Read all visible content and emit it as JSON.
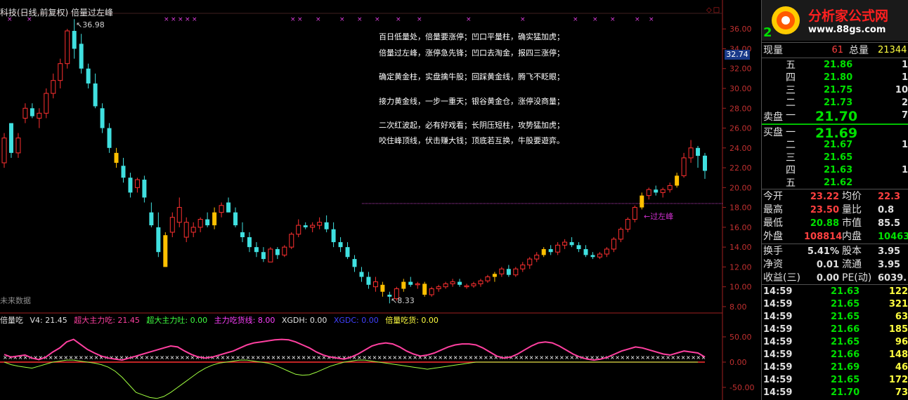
{
  "chart": {
    "title": "科技(日线,前复权) 倍量过左峰",
    "current_price_label": "32.74",
    "high_marker": "36.98",
    "low_marker": "8.33",
    "future_label": "未来数据",
    "breakout_label": "过左峰",
    "window_buttons": "◇□",
    "price_ticks": [
      "36.00",
      "34.00",
      "32.00",
      "30.00",
      "28.00",
      "26.00",
      "24.00",
      "22.00",
      "20.00",
      "18.00",
      "16.00",
      "14.00",
      "12.00",
      "10.00",
      "8.00"
    ],
    "poem_lines": [
      "百日低量处，倍量要涨停；凹口平量柱，确实猛加虎；",
      "倍量过左峰，涨停急先锋；凹口去淘金，报四三涨停；",
      "确定黄金柱，实盘擒牛股；回踩黄金线，腾飞不眨眼；",
      "接力黄金线，一步一重天；银谷黄金仓，涨停没商量；",
      "二次红波起，必有好戏看；长阴压短柱，攻势猛加虎；",
      "咬住峰顶线，伏击赚大钱；顶底若互换，牛股要遊弈。"
    ],
    "colors": {
      "up": "#ff3030",
      "down": "#40e0e0",
      "gold": "#ffc000",
      "ind_pink": "#ff40a0",
      "ind_green": "#a0ff40",
      "ind_white": "#ffffff"
    }
  },
  "indicator": {
    "name": "倍量吃",
    "v4": "V4: 21.45",
    "main_eat": "超大主力吃: 21.45",
    "main_spit": "超大主力吐: 0.00",
    "main_accum": "主力吃货线: 8.00",
    "xgdh": "XGDH: 0.00",
    "xgdc": "XGDC: 0.00",
    "double_eat": "倍量吃货: 0.00",
    "ticks": [
      "50.00",
      "0.00",
      "-50.00"
    ]
  },
  "panel": {
    "logo_text": "分析家公式网",
    "logo_url": "www.88gs.com",
    "code_partial": "2",
    "volume": {
      "now_label": "现量",
      "now_value": "61",
      "total_label": "总量",
      "total_value": "21344"
    },
    "asks": [
      {
        "label": "五",
        "price": "21.86",
        "vol": "1"
      },
      {
        "label": "四",
        "price": "21.80",
        "vol": "1"
      },
      {
        "label": "三",
        "price": "21.75",
        "vol": "10"
      },
      {
        "label": "二",
        "price": "21.73",
        "vol": "2"
      },
      {
        "label": "一",
        "price": "21.70",
        "vol": "7"
      }
    ],
    "ask_side_label": "卖盘",
    "bid_side_label": "买盘",
    "bids": [
      {
        "label": "一",
        "price": "21.69",
        "vol": ""
      },
      {
        "label": "二",
        "price": "21.67",
        "vol": "1"
      },
      {
        "label": "三",
        "price": "21.65",
        "vol": ""
      },
      {
        "label": "四",
        "price": "21.63",
        "vol": "1"
      },
      {
        "label": "五",
        "price": "21.62",
        "vol": ""
      }
    ],
    "stats": [
      {
        "l1": "今开",
        "v1": "23.22",
        "l2": "均价",
        "v2": "22.3"
      },
      {
        "l1": "最高",
        "v1": "23.50",
        "l2": "量比",
        "v2": "0.8"
      },
      {
        "l1": "最低",
        "v1": "20.88",
        "l2": "市值",
        "v2": "85.5"
      },
      {
        "l1": "外盘",
        "v1": "108814",
        "l2": "内盘",
        "v2": "10463"
      }
    ],
    "fundamentals": [
      {
        "l1": "换手",
        "v1": "5.41%",
        "l2": "股本",
        "v2": "3.95"
      },
      {
        "l1": "净资",
        "v1": "0.01",
        "l2": "流通",
        "v2": "3.95"
      },
      {
        "l1": "收益(三)",
        "v1": "0.00",
        "l2": "PE(动)",
        "v2": "6039."
      }
    ],
    "ticks": [
      {
        "time": "14:59",
        "price": "21.63",
        "vol": "122"
      },
      {
        "time": "14:59",
        "price": "21.65",
        "vol": "321"
      },
      {
        "time": "14:59",
        "price": "21.65",
        "vol": "63"
      },
      {
        "time": "14:59",
        "price": "21.66",
        "vol": "185"
      },
      {
        "time": "14:59",
        "price": "21.65",
        "vol": "96"
      },
      {
        "time": "14:59",
        "price": "21.66",
        "vol": "148"
      },
      {
        "time": "14:59",
        "price": "21.69",
        "vol": "46"
      },
      {
        "time": "14:59",
        "price": "21.65",
        "vol": "172"
      },
      {
        "time": "14:59",
        "price": "21.70",
        "vol": "73"
      }
    ]
  },
  "chart_data": {
    "type": "candlestick",
    "y_range": [
      7.5,
      37.5
    ],
    "candles": [
      [
        22.5,
        25.5,
        22.0,
        25.0
      ],
      [
        26.5,
        26.5,
        23.0,
        23.5
      ],
      [
        23.5,
        25.5,
        23.0,
        25.0
      ],
      [
        27.0,
        28.5,
        26.5,
        28.0
      ],
      [
        28.0,
        28.5,
        27.0,
        27.2
      ],
      [
        27.0,
        28.0,
        26.0,
        27.5
      ],
      [
        27.5,
        30.0,
        27.0,
        29.5
      ],
      [
        29.5,
        31.5,
        29.0,
        30.8
      ],
      [
        30.8,
        33.0,
        30.0,
        32.5
      ],
      [
        32.5,
        36.0,
        32.0,
        35.8
      ],
      [
        35.8,
        36.98,
        33.0,
        34.0
      ],
      [
        34.5,
        35.5,
        31.5,
        32.0
      ],
      [
        32.0,
        32.5,
        30.0,
        30.5
      ],
      [
        30.5,
        31.5,
        28.0,
        28.2
      ],
      [
        28.0,
        28.5,
        25.5,
        26.0
      ],
      [
        26.0,
        26.5,
        23.5,
        24.0
      ],
      [
        23.5,
        24.0,
        22.0,
        22.5
      ],
      [
        22.2,
        23.0,
        20.5,
        21.0
      ],
      [
        21.0,
        21.5,
        19.0,
        19.5
      ],
      [
        20.0,
        21.0,
        19.5,
        20.8
      ],
      [
        20.8,
        21.2,
        18.5,
        19.0
      ],
      [
        17.5,
        18.5,
        16.0,
        16.2
      ],
      [
        16.0,
        17.5,
        13.0,
        13.5
      ],
      [
        12.0,
        15.5,
        12.0,
        15.2
      ],
      [
        15.5,
        17.5,
        15.0,
        17.0
      ],
      [
        16.5,
        19.0,
        16.0,
        18.0
      ],
      [
        15.0,
        17.0,
        14.5,
        16.5
      ],
      [
        15.5,
        16.5,
        15.0,
        16.0
      ],
      [
        16.0,
        17.0,
        15.5,
        16.8
      ],
      [
        16.8,
        17.5,
        16.0,
        16.2
      ],
      [
        16.2,
        18.0,
        15.8,
        17.5
      ],
      [
        17.5,
        18.5,
        17.0,
        18.2
      ],
      [
        18.5,
        19.0,
        17.5,
        17.5
      ],
      [
        17.5,
        18.0,
        16.0,
        16.2
      ],
      [
        15.5,
        16.5,
        14.5,
        15.0
      ],
      [
        15.0,
        15.5,
        13.5,
        14.0
      ],
      [
        14.0,
        14.5,
        13.0,
        13.5
      ],
      [
        13.5,
        14.0,
        12.5,
        12.8
      ],
      [
        12.5,
        14.0,
        12.5,
        13.8
      ],
      [
        13.8,
        14.0,
        12.8,
        13.2
      ],
      [
        13.2,
        14.2,
        13.0,
        14.0
      ],
      [
        14.0,
        15.5,
        13.8,
        15.3
      ],
      [
        15.3,
        16.8,
        15.0,
        16.2
      ],
      [
        16.2,
        16.5,
        15.8,
        16.0
      ],
      [
        16.0,
        16.5,
        15.5,
        16.2
      ],
      [
        16.2,
        17.0,
        15.8,
        16.5
      ],
      [
        16.5,
        17.2,
        15.5,
        15.8
      ],
      [
        15.8,
        16.5,
        14.0,
        14.5
      ],
      [
        14.5,
        15.0,
        13.5,
        14.0
      ],
      [
        14.0,
        14.5,
        12.8,
        13.0
      ],
      [
        12.8,
        13.2,
        11.5,
        12.0
      ],
      [
        11.5,
        12.0,
        10.5,
        11.0
      ],
      [
        11.0,
        11.5,
        9.8,
        10.2
      ],
      [
        10.0,
        11.0,
        9.5,
        10.5
      ],
      [
        10.2,
        10.5,
        9.0,
        9.5
      ],
      [
        9.2,
        9.5,
        8.33,
        9.0
      ],
      [
        8.8,
        10.0,
        8.6,
        9.8
      ],
      [
        9.8,
        10.8,
        9.5,
        10.5
      ],
      [
        10.5,
        11.0,
        10.0,
        10.2
      ],
      [
        10.2,
        10.5,
        9.8,
        10.3
      ],
      [
        10.3,
        10.5,
        9.0,
        9.2
      ],
      [
        9.2,
        10.0,
        9.0,
        9.8
      ],
      [
        9.8,
        10.2,
        9.5,
        10.0
      ],
      [
        10.0,
        10.5,
        9.8,
        10.3
      ],
      [
        10.3,
        10.8,
        10.0,
        10.5
      ],
      [
        10.5,
        10.8,
        10.0,
        10.2
      ],
      [
        10.0,
        10.3,
        9.8,
        10.1
      ],
      [
        10.1,
        10.5,
        9.9,
        10.3
      ],
      [
        10.3,
        10.8,
        10.0,
        10.6
      ],
      [
        10.6,
        11.2,
        10.4,
        11.0
      ],
      [
        11.0,
        11.5,
        10.5,
        11.3
      ],
      [
        11.3,
        12.0,
        11.0,
        11.8
      ],
      [
        11.8,
        12.2,
        11.0,
        11.2
      ],
      [
        11.2,
        12.0,
        11.0,
        11.8
      ],
      [
        11.8,
        12.5,
        11.5,
        12.2
      ],
      [
        12.2,
        13.0,
        11.8,
        12.8
      ],
      [
        12.8,
        13.5,
        12.5,
        13.2
      ],
      [
        13.2,
        14.0,
        13.0,
        13.8
      ],
      [
        13.8,
        14.2,
        13.2,
        13.5
      ],
      [
        13.5,
        14.5,
        13.2,
        14.2
      ],
      [
        14.2,
        14.8,
        13.8,
        14.5
      ],
      [
        14.5,
        15.0,
        14.0,
        14.2
      ],
      [
        14.2,
        14.5,
        13.5,
        13.8
      ],
      [
        13.8,
        14.2,
        13.0,
        13.2
      ],
      [
        13.2,
        13.5,
        12.8,
        13.0
      ],
      [
        13.0,
        13.5,
        12.8,
        13.3
      ],
      [
        13.3,
        14.0,
        13.0,
        13.8
      ],
      [
        13.8,
        15.0,
        13.5,
        14.8
      ],
      [
        14.8,
        16.0,
        14.5,
        15.8
      ],
      [
        15.8,
        17.0,
        15.5,
        16.8
      ],
      [
        16.8,
        18.2,
        16.5,
        18.0
      ],
      [
        18.0,
        19.5,
        17.8,
        19.2
      ],
      [
        19.2,
        20.0,
        18.8,
        19.8
      ],
      [
        19.8,
        20.2,
        19.2,
        19.5
      ],
      [
        19.5,
        20.0,
        19.0,
        19.8
      ],
      [
        19.8,
        20.5,
        19.5,
        20.2
      ],
      [
        20.2,
        21.5,
        20.0,
        21.2
      ],
      [
        21.2,
        23.5,
        21.0,
        23.0
      ],
      [
        23.0,
        24.8,
        22.5,
        24.0
      ],
      [
        24.0,
        24.2,
        22.0,
        23.2
      ],
      [
        23.22,
        23.5,
        20.88,
        21.69
      ]
    ],
    "gold_bars": [
      16,
      23,
      30,
      54,
      57,
      60,
      70,
      77,
      91,
      96
    ],
    "indicator_series": [
      {
        "name": "超大主力吃",
        "values": [
          15,
          10,
          12,
          14,
          8,
          5,
          10,
          20,
          28,
          40,
          45,
          35,
          25,
          18,
          12,
          8,
          6,
          4,
          8,
          12,
          16,
          20,
          24,
          28,
          32,
          30,
          22,
          15,
          10,
          8,
          10,
          14,
          18,
          22,
          28,
          34,
          38,
          40,
          42,
          44,
          45,
          44,
          40,
          34,
          28,
          20,
          14,
          10,
          8,
          6,
          10,
          16,
          24,
          32,
          36,
          38,
          36,
          30,
          22,
          16,
          12,
          14,
          18,
          24,
          30,
          34,
          36,
          36,
          34,
          28,
          20,
          12,
          8,
          10,
          16,
          24,
          32,
          38,
          40,
          38,
          32,
          24,
          16,
          10,
          6,
          4,
          6,
          10,
          16,
          22,
          26,
          30,
          28,
          24,
          20,
          16,
          14,
          18,
          22,
          20,
          18,
          10
        ]
      },
      {
        "name": "主力吃货线",
        "values": [
          0,
          -5,
          -8,
          -10,
          -12,
          -8,
          -4,
          0,
          2,
          4,
          4,
          2,
          0,
          -2,
          -5,
          -10,
          -18,
          -30,
          -45,
          -60,
          -65,
          -70,
          -72,
          -68,
          -60,
          -50,
          -40,
          -30,
          -20,
          -12,
          -6,
          -2,
          0,
          2,
          4,
          4,
          2,
          0,
          -2,
          -6,
          -12,
          -18,
          -24,
          -26,
          -25,
          -20,
          -14,
          -8,
          -4,
          0,
          2,
          4,
          4,
          2,
          0,
          -2,
          -4,
          -6,
          -8,
          -10,
          -12,
          -14,
          -12,
          -10,
          -8,
          -6,
          -4,
          -2,
          0,
          0,
          0,
          0,
          0,
          0,
          0,
          0,
          0,
          0,
          0,
          0,
          0,
          0,
          0,
          0,
          0,
          0,
          0,
          0,
          0,
          0,
          0,
          0,
          0,
          0,
          0,
          0,
          0,
          0,
          0,
          0,
          0
        ]
      }
    ]
  }
}
